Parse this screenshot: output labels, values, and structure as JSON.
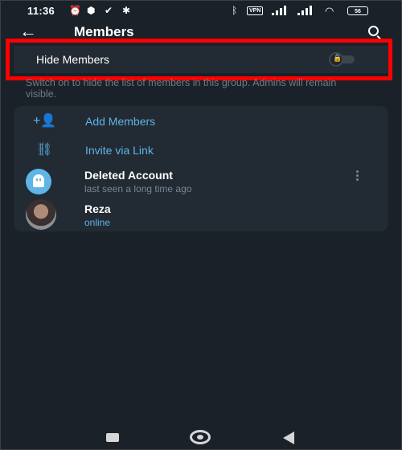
{
  "status_bar": {
    "time": "11:36",
    "vpn": "VPN",
    "battery": "56"
  },
  "header": {
    "title": "Members"
  },
  "hide_members": {
    "label": "Hide Members",
    "enabled": false,
    "description": "Switch on to hide the list of members in this group. Admins will remain visible."
  },
  "actions": [
    {
      "label": "Add Members",
      "icon": "add-user-icon"
    },
    {
      "label": "Invite via Link",
      "icon": "link-icon"
    }
  ],
  "members": [
    {
      "name": "Deleted Account",
      "status": "last seen a long time ago",
      "avatar": "ghost-icon"
    },
    {
      "name": "Reza",
      "status": "online",
      "avatar": "photo"
    }
  ],
  "colors": {
    "background": "#1a2129",
    "card": "#222a33",
    "accent": "#5fb4e8",
    "highlight": "#ff0000"
  }
}
